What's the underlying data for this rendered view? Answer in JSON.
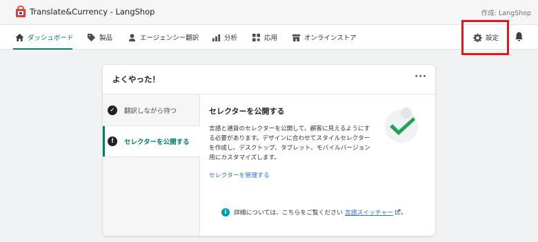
{
  "app": {
    "title": "Translate&Currency - LangShop",
    "author": "作成: LangShop"
  },
  "nav": {
    "items": [
      {
        "label": "ダッシュボード",
        "icon": "home-icon",
        "active": true
      },
      {
        "label": "製品",
        "icon": "tag-icon"
      },
      {
        "label": "エージェンシー翻訳",
        "icon": "translator-icon"
      },
      {
        "label": "分析",
        "icon": "bar-chart-icon"
      },
      {
        "label": "応用",
        "icon": "apps-icon"
      },
      {
        "label": "オンラインストア",
        "icon": "store-icon"
      }
    ],
    "settings": {
      "label": "設定",
      "icon": "gear-icon"
    },
    "bell_icon": "bell-icon"
  },
  "card": {
    "title": "よくやった！",
    "more_label": "···",
    "steps": [
      {
        "label": "翻訳しながら待つ",
        "status": "done",
        "icon_glyph": "✓"
      },
      {
        "label": "セレクターを公開する",
        "status": "current",
        "icon_glyph": "!"
      }
    ],
    "content": {
      "title": "セレクターを公開する",
      "description": "言語と通貨のセレクターを公開して、顧客に見えるようにする必要があります。デザインに合わせてスタイルセレクターを作成し、デスクトップ、タブレット、モバイルバージョン用にカスタマイズします。",
      "link": "セレクターを管理する"
    },
    "info": {
      "icon_glyph": "i",
      "text": "詳細については、こちらをご覧ください",
      "link": "言語スイッチャー",
      "suffix": "。"
    }
  },
  "colors": {
    "accent": "#008060",
    "link": "#2c6ecb",
    "highlight_box": "#e3161b",
    "check_green": "#1fa35b"
  }
}
